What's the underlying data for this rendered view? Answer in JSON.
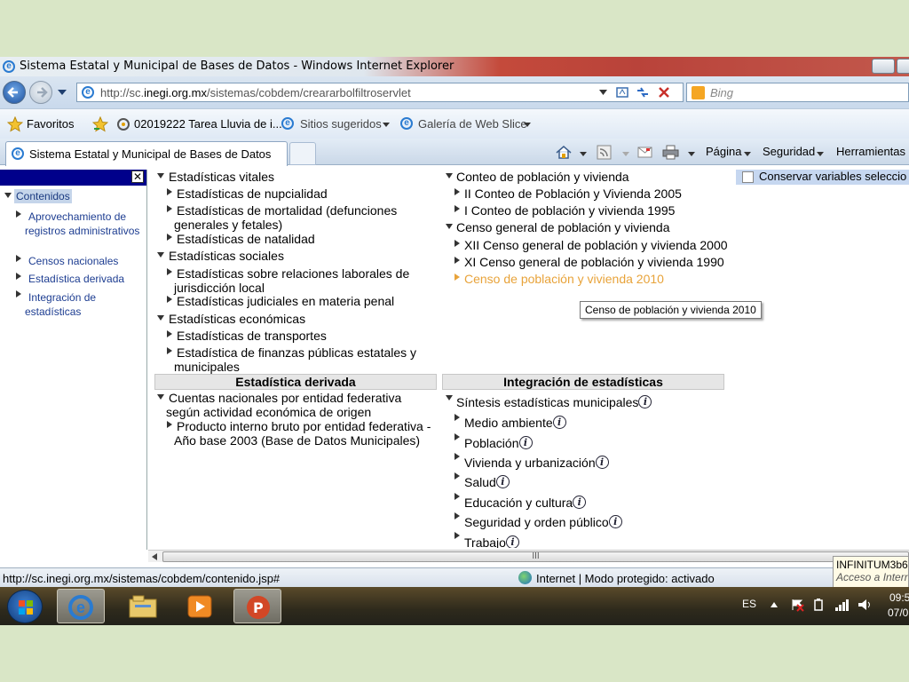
{
  "window": {
    "title": "Sistema Estatal y Municipal de Bases de Datos - Windows Internet Explorer"
  },
  "address_bar": {
    "url_prefix": "http://sc.",
    "url_domain": "inegi.org.mx",
    "url_path": "/sistemas/cobdem/creararbolfiltroservlet",
    "search_placeholder": "Bing"
  },
  "favorites_bar": {
    "favorites_label": "Favoritos",
    "link1": "02019222 Tarea Lluvia de i...",
    "link2": "Sitios sugeridos",
    "link3": "Galería de Web Slice"
  },
  "tab": {
    "title": "Sistema Estatal y Municipal de Bases de Datos"
  },
  "command_bar": {
    "page": "Página",
    "security": "Seguridad",
    "tools": "Herramientas"
  },
  "left_panel": {
    "root": "Contenidos",
    "items": [
      "Aprovechamiento de registros administrativos",
      "Censos nacionales",
      "Estadística derivada",
      "Integración de estadísticas"
    ]
  },
  "tree": {
    "vitales": "Estadísticas vitales",
    "nupcialidad": "Estadísticas de nupcialidad",
    "mortalidad": "Estadísticas de mortalidad (defunciones generales y fetales)",
    "natalidad": "Estadísticas de natalidad",
    "sociales": "Estadísticas sociales",
    "laborales": "Estadísticas sobre relaciones laborales de jurisdicción local",
    "judiciales": "Estadísticas judiciales en materia penal",
    "economicas": "Estadísticas económicas",
    "transportes": "Estadísticas de transportes",
    "finanzas": "Estadística de finanzas públicas estatales y municipales",
    "conteo": "Conteo de población y vivienda",
    "conteo2005": "II Conteo de Población y Vivienda 2005",
    "conteo1995": "I Conteo de población y vivienda 1995",
    "censo": "Censo general de población y vivienda",
    "censo2000": "XII Censo general de población y vivienda 2000",
    "censo1990": "XI Censo general de población y vivienda 1990",
    "censo2010": "Censo de población y vivienda 2010",
    "tooltip": "Censo de población y vivienda 2010",
    "derivada_header": "Estadística derivada",
    "cuentas": "Cuentas nacionales por entidad federativa según actividad económica de origen",
    "pib": "Producto interno bruto por entidad federativa - Año base 2003 (Base de Datos Municipales)",
    "integracion_header": "Integración de estadísticas",
    "sintesis": "Síntesis estadísticas municipales",
    "medio": "Medio ambiente",
    "poblacion": "Población",
    "vivienda": "Vivienda y urbanización",
    "salud": "Salud",
    "educacion": "Educación y cultura",
    "seguridad": "Seguridad y orden público",
    "trabajo": "Trabajo"
  },
  "conservar_label": "Conservar variables seleccio",
  "status_bar": {
    "url": "http://sc.inegi.org.mx/sistemas/cobdem/contenido.jsp#",
    "zone": "Internet | Modo protegido: activado"
  },
  "notification": {
    "line1": "INFINITUM3b6",
    "line2": "Acceso a Intern"
  },
  "taskbar": {
    "lang": "ES",
    "time": "09:5",
    "date": "07/0"
  },
  "colors": {
    "link_blue": "#1d3d91",
    "highlight_orange": "#e8a33a",
    "left_header": "#00008b"
  }
}
